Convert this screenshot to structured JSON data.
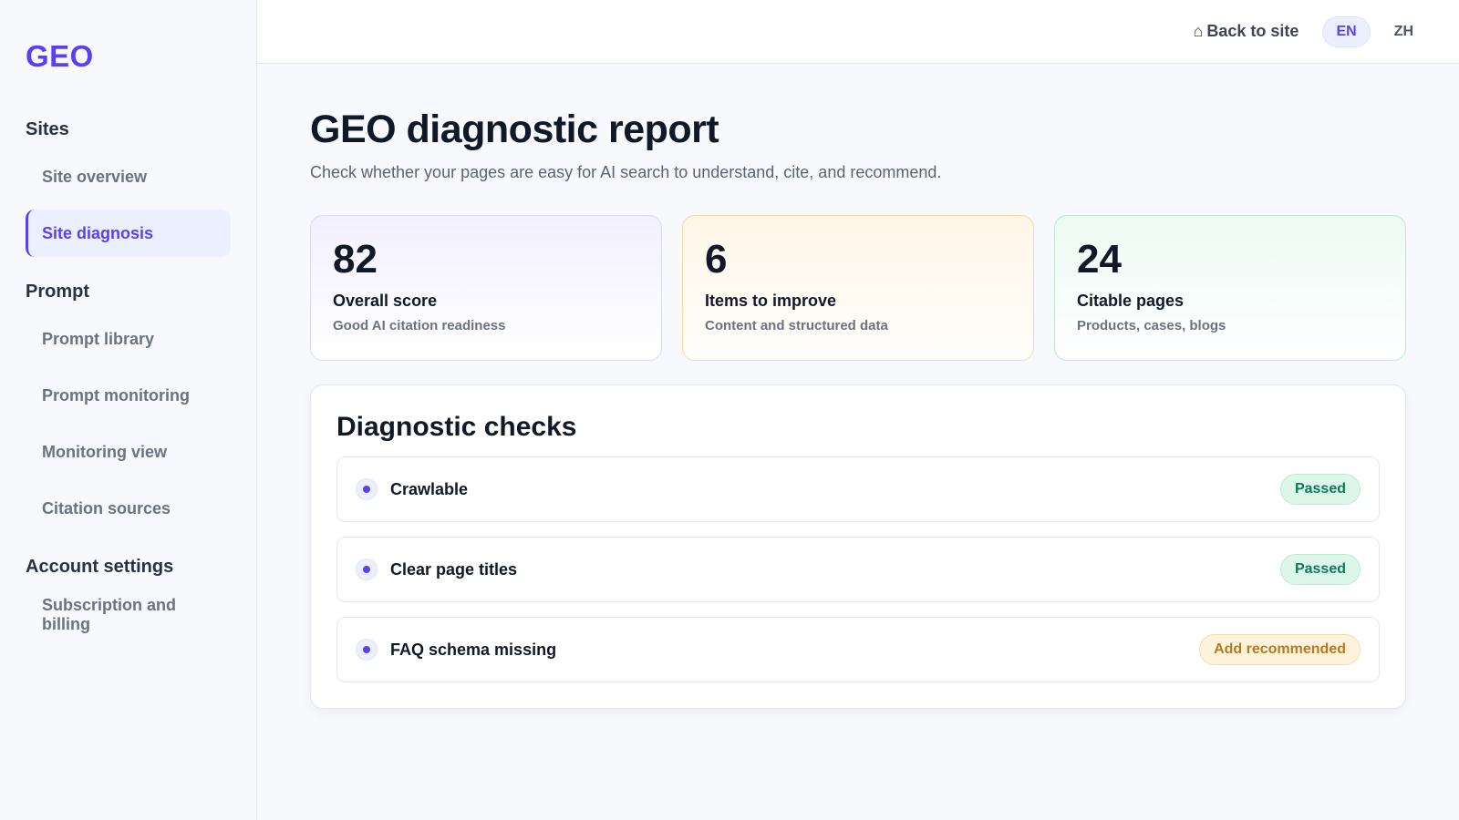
{
  "app": {
    "logo": "GEO"
  },
  "sidebar": {
    "sections": [
      {
        "title": "Sites",
        "items": [
          "Site overview",
          "Site diagnosis"
        ]
      },
      {
        "title": "Prompt",
        "items": [
          "Prompt library",
          "Prompt monitoring",
          "Monitoring view",
          "Citation sources"
        ]
      },
      {
        "title": "Account settings",
        "items": [
          "Subscription and billing"
        ]
      }
    ],
    "active_item": "Site diagnosis"
  },
  "topbar": {
    "back_icon": "home-icon",
    "back_glyph": "⌂",
    "back_label": "Back to site",
    "languages": [
      "EN",
      "ZH"
    ],
    "active_language": "EN"
  },
  "page": {
    "title": "GEO diagnostic report",
    "subtitle": "Check whether your pages are easy for AI search to understand, cite, and recommend."
  },
  "stats": [
    {
      "value": "82",
      "label": "Overall score",
      "desc": "Good AI citation readiness"
    },
    {
      "value": "6",
      "label": "Items to improve",
      "desc": "Content and structured data"
    },
    {
      "value": "24",
      "label": "Citable pages",
      "desc": "Products, cases, blogs"
    }
  ],
  "checks": {
    "title": "Diagnostic checks",
    "items": [
      {
        "label": "Crawlable",
        "status": "Passed",
        "status_type": "passed"
      },
      {
        "label": "Clear page titles",
        "status": "Passed",
        "status_type": "passed"
      },
      {
        "label": "FAQ schema missing",
        "status": "Add recommended",
        "status_type": "warn"
      }
    ]
  },
  "colors": {
    "accent": "#5b3ff0",
    "passed": "#0f7a58",
    "warn": "#b7791f"
  }
}
